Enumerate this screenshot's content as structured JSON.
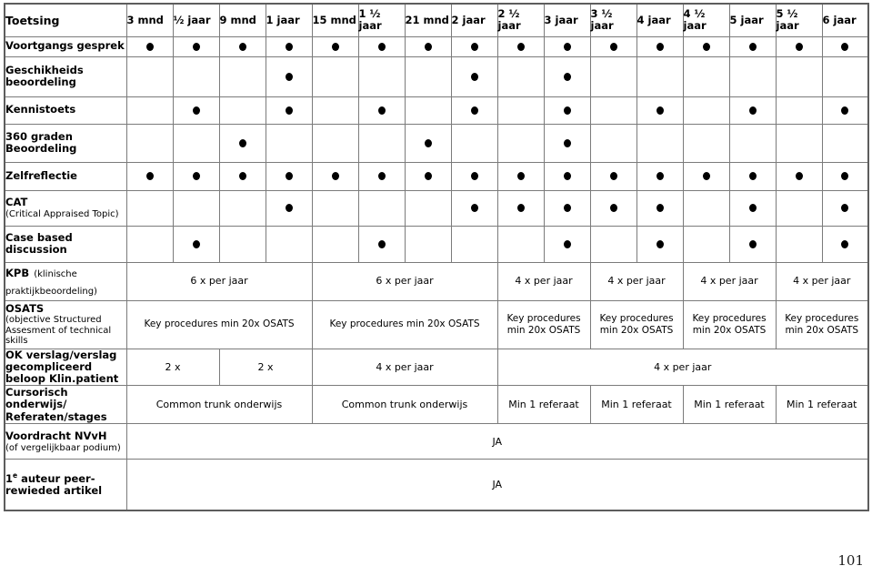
{
  "document": {
    "page_number": "101"
  },
  "table": {
    "corner_label": "Toetsing",
    "columns": [
      "3 mnd",
      "½ jaar",
      "9 mnd",
      "1 jaar",
      "15 mnd",
      "1 ½ jaar",
      "21 mnd",
      "2 jaar",
      "2 ½ jaar",
      "3 jaar",
      "3 ½ jaar",
      "4 jaar",
      "4 ½ jaar",
      "5 jaar",
      "5 ½ jaar",
      "6 jaar"
    ],
    "rows": [
      {
        "id": "voortgangs-gesprek",
        "label_bold": "Voortgangs gesprek",
        "label_sub": "",
        "type": "dots",
        "dots": [
          true,
          true,
          true,
          true,
          true,
          true,
          true,
          true,
          true,
          true,
          true,
          true,
          true,
          true,
          true,
          true
        ]
      },
      {
        "id": "geschikheids-beoordeling",
        "label_bold": "Geschikheids beoordeling",
        "label_sub": "",
        "type": "dots",
        "dots": [
          false,
          false,
          false,
          true,
          false,
          false,
          false,
          true,
          false,
          true,
          false,
          false,
          false,
          false,
          false,
          false
        ]
      },
      {
        "id": "kennistoets",
        "label_bold": "Kennistoets",
        "label_sub": "",
        "type": "dots",
        "dots": [
          false,
          true,
          false,
          true,
          false,
          true,
          false,
          true,
          false,
          true,
          false,
          true,
          false,
          true,
          false,
          true
        ]
      },
      {
        "id": "360-graden-beoordeling",
        "label_bold": "360 graden Beoordeling",
        "label_sub": "",
        "type": "dots",
        "dots": [
          false,
          false,
          true,
          false,
          false,
          false,
          true,
          false,
          false,
          true,
          false,
          false,
          false,
          false,
          false,
          false
        ]
      },
      {
        "id": "zelfreflectie",
        "label_bold": "Zelfreflectie",
        "label_sub": "",
        "type": "dots",
        "dots": [
          true,
          true,
          true,
          true,
          true,
          true,
          true,
          true,
          true,
          true,
          true,
          true,
          true,
          true,
          true,
          true
        ]
      },
      {
        "id": "cat",
        "label_bold": "CAT",
        "label_sub": "(Critical Appraised Topic)",
        "type": "dots",
        "dots": [
          false,
          false,
          false,
          true,
          false,
          false,
          false,
          true,
          true,
          true,
          true,
          true,
          false,
          true,
          false,
          true
        ]
      },
      {
        "id": "case-based-discussion",
        "label_bold": "Case based discussion",
        "label_sub": "",
        "type": "dots",
        "dots": [
          false,
          true,
          false,
          false,
          false,
          true,
          false,
          false,
          false,
          true,
          false,
          true,
          false,
          true,
          false,
          true
        ]
      },
      {
        "id": "kpb",
        "label_bold": "KPB",
        "label_sub": "(klinische praktijkbeoordeling)",
        "type": "spans",
        "cells": [
          {
            "span": 4,
            "text": "6 x per jaar"
          },
          {
            "span": 4,
            "text": "6 x per jaar"
          },
          {
            "span": 2,
            "text": "4 x per jaar"
          },
          {
            "span": 2,
            "text": "4 x per jaar"
          },
          {
            "span": 2,
            "text": "4 x per jaar"
          },
          {
            "span": 2,
            "text": "4 x per jaar"
          }
        ]
      },
      {
        "id": "osats",
        "label_bold": "OSATS",
        "label_sub": "(objective Structured Assesment of technical skills",
        "type": "spans",
        "cells": [
          {
            "span": 4,
            "text": "Key procedures min 20x OSATS"
          },
          {
            "span": 4,
            "text": "Key procedures min 20x OSATS"
          },
          {
            "span": 2,
            "text": "Key procedures min 20x OSATS"
          },
          {
            "span": 2,
            "text": "Key procedures min 20x OSATS"
          },
          {
            "span": 2,
            "text": "Key procedures min 20x OSATS"
          },
          {
            "span": 2,
            "text": "Key procedures min 20x OSATS"
          }
        ]
      },
      {
        "id": "ok-verslag",
        "label_bold": "OK verslag/verslag gecompliceerd beloop Klin.patient",
        "label_sub": "",
        "type": "spans",
        "cells": [
          {
            "span": 2,
            "text": "2 x"
          },
          {
            "span": 2,
            "text": "2 x"
          },
          {
            "span": 4,
            "text": "4 x per jaar"
          },
          {
            "span": 8,
            "text": "4 x per jaar"
          }
        ]
      },
      {
        "id": "cursorisch-onderwijs",
        "label_bold": "Cursorisch onderwijs/ Referaten/stages",
        "label_sub": "",
        "type": "spans",
        "cells": [
          {
            "span": 4,
            "text": "Common trunk onderwijs"
          },
          {
            "span": 4,
            "text": "Common trunk onderwijs"
          },
          {
            "span": 2,
            "text": "Min 1 referaat"
          },
          {
            "span": 2,
            "text": "Min 1 referaat"
          },
          {
            "span": 2,
            "text": "Min 1 referaat"
          },
          {
            "span": 2,
            "text": "Min 1 referaat"
          }
        ]
      },
      {
        "id": "voordracht-nvvh",
        "label_bold": "Voordracht NVvH",
        "label_sub": "(of vergelijkbaar podium)",
        "type": "spans",
        "cells": [
          {
            "span": 16,
            "text": "JA"
          }
        ]
      },
      {
        "id": "eerste-auteur-artikel",
        "label_bold": "1e auteur peer- rewieded artikel",
        "label_sub": "",
        "type": "spans",
        "cells": [
          {
            "span": 16,
            "text": "JA"
          }
        ]
      }
    ]
  }
}
